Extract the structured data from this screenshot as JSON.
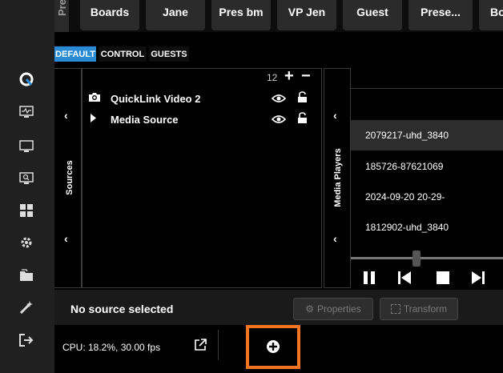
{
  "scenes": {
    "prev_label": "Pre",
    "buttons": [
      "Boards",
      "Jane",
      "Pres bm",
      "VP Jen",
      "Guest",
      "Prese...",
      "Bo"
    ]
  },
  "tabs": [
    "DEFAULT",
    "CONTROL",
    "GUESTS"
  ],
  "sources": {
    "label": "Sources",
    "count": "12",
    "items": [
      {
        "name": "QuickLink Video 2",
        "icon": "camera-icon"
      },
      {
        "name": "Media Source",
        "icon": "play-icon"
      }
    ]
  },
  "media_players": {
    "label": "Media Players",
    "items": [
      "2079217-uhd_3840",
      "185726-87621069",
      "2024-09-20 20-29-",
      "1812902-uhd_3840"
    ],
    "selected_index": 0
  },
  "properties_bar": {
    "status": "No source selected",
    "properties_label": "Properties",
    "transform_label": "Transform"
  },
  "status_bar": {
    "cpu": "CPU: 18.2%, 30.00 fps"
  },
  "colors": {
    "accent": "#2a8ad4",
    "highlight": "#f07422"
  }
}
